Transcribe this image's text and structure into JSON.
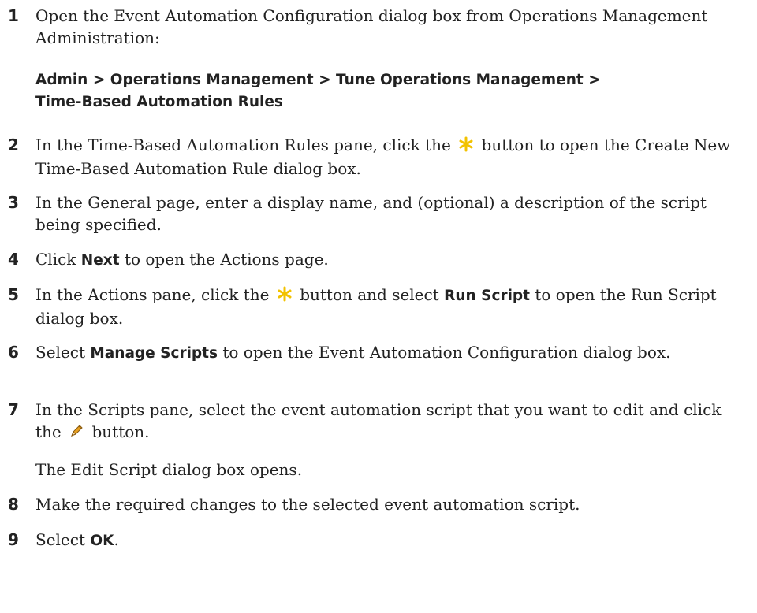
{
  "steps": [
    {
      "num": "1",
      "text": "Open the Event Automation Configuration dialog box from Operations Management Administration:"
    },
    {
      "num": "2",
      "pre": "In the Time-Based Automation Rules pane, click the",
      "post": "button to open the Create New Time-Based Automation Rule dialog box.",
      "icon": "new-asterisk-icon"
    },
    {
      "num": "3",
      "text": "In the General page, enter a display name, and (optional) a description of the script being specified."
    },
    {
      "num": "4",
      "pre": "Click",
      "bold": "Next",
      "post": "to open the Actions page."
    },
    {
      "num": "5",
      "pre": "In the Actions pane, click the",
      "mid": "button and select",
      "bold": "Run Script",
      "post": "to open the Run Script dialog box.",
      "icon": "new-asterisk-icon"
    },
    {
      "num": "6",
      "pre": "Select",
      "bold": "Manage Scripts",
      "post": "to open the Event Automation Configuration dialog box."
    },
    {
      "num": "7",
      "pre": "In the Scripts pane, select the event automation script that you want to edit and click the",
      "post": "button.",
      "icon": "pencil-edit-icon"
    },
    {
      "num": "8",
      "text": "Make the required changes to the selected event automation script."
    },
    {
      "num": "9",
      "pre": "Select",
      "bold": "OK",
      "post": "."
    }
  ],
  "nav_path": {
    "items": [
      "Admin",
      "Operations Management",
      "Tune Operations Management",
      "Time-Based Automation Rules"
    ],
    "separator": ">"
  },
  "step7_note": "The Edit Script dialog box opens.",
  "colors": {
    "text": "#222222",
    "asterisk": "#f2c200",
    "pencil": "#e8a020"
  }
}
